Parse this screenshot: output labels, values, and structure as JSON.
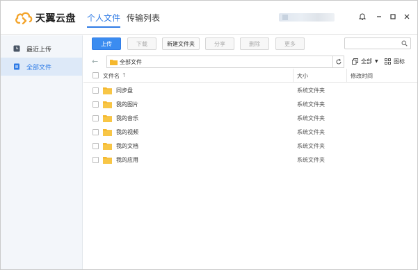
{
  "app": {
    "name": "天翼云盘",
    "brand_color": "#f3a42b",
    "accent_color": "#2f7be5"
  },
  "nav_tabs": [
    {
      "label": "个人文件",
      "active": true
    },
    {
      "label": "传输列表",
      "active": false
    }
  ],
  "window_controls": {
    "bell_icon": "bell-icon",
    "min_icon": "minimize-icon",
    "max_icon": "maximize-icon",
    "close_icon": "close-icon"
  },
  "sidebar": {
    "items": [
      {
        "label": "最近上传",
        "icon": "clock-icon",
        "active": false
      },
      {
        "label": "全部文件",
        "icon": "file-icon",
        "active": true
      }
    ]
  },
  "toolbar": {
    "upload": "上传",
    "download": "下载",
    "new_folder": "新建文件夹",
    "share": "分享",
    "delete": "删除",
    "more": "更多",
    "search_placeholder": ""
  },
  "path": {
    "current": "全部文件"
  },
  "view": {
    "filter_label": "全部",
    "icon_view_label": "图标"
  },
  "columns": {
    "name": "文件名",
    "sort_indicator": "↑",
    "size": "大小",
    "modified": "修改时间"
  },
  "files": [
    {
      "name": "同步盘",
      "size": "系统文件夹"
    },
    {
      "name": "我的图片",
      "size": "系统文件夹"
    },
    {
      "name": "我的音乐",
      "size": "系统文件夹"
    },
    {
      "name": "我的视频",
      "size": "系统文件夹"
    },
    {
      "name": "我的文档",
      "size": "系统文件夹"
    },
    {
      "name": "我的应用",
      "size": "系统文件夹"
    }
  ]
}
